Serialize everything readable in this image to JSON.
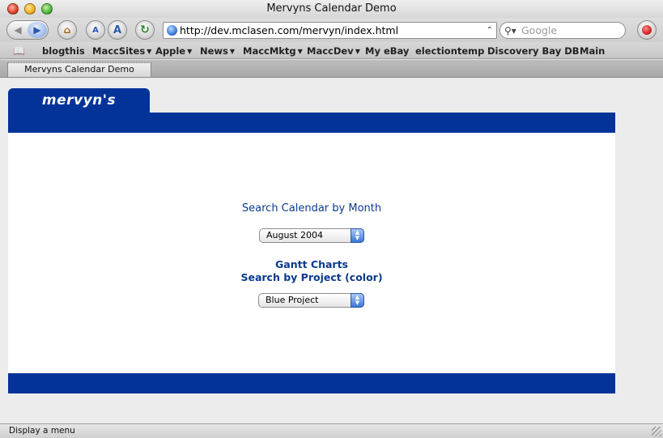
{
  "window": {
    "title": "Mervyns Calendar Demo"
  },
  "toolbar": {
    "back_icon": "back-arrow-icon",
    "forward_icon": "forward-arrow-icon",
    "home_icon": "home-icon",
    "text_smaller_label": "A",
    "text_bigger_label": "A",
    "reload_icon": "reload-icon",
    "url": "http://dev.mclasen.com/mervyn/index.html",
    "search_placeholder": "Google",
    "bug_icon": "bug-report-icon"
  },
  "bookmarks": {
    "items": [
      {
        "label": "blogthis",
        "menu": false
      },
      {
        "label": "MaccSites",
        "menu": true
      },
      {
        "label": "Apple",
        "menu": true
      },
      {
        "label": "News",
        "menu": true
      },
      {
        "label": "MaccMktg",
        "menu": true
      },
      {
        "label": "MaccDev",
        "menu": true
      },
      {
        "label": "My eBay",
        "menu": false
      },
      {
        "label": "electiontemp",
        "menu": false
      },
      {
        "label": "Discovery Bay DB",
        "menu": false
      },
      {
        "label": "Main",
        "menu": false
      }
    ]
  },
  "tabs": [
    {
      "label": "Mervyns Calendar Demo",
      "active": true
    }
  ],
  "page": {
    "logo": "mervyn's",
    "brand_color": "#033399",
    "month_heading": "Search Calendar by Month",
    "month_select": {
      "selected": "August 2004"
    },
    "gantt_heading": "Gantt Charts",
    "project_heading": "Search by Project (color)",
    "project_select": {
      "selected": "Blue Project"
    }
  },
  "status": {
    "text": "Display a menu"
  }
}
